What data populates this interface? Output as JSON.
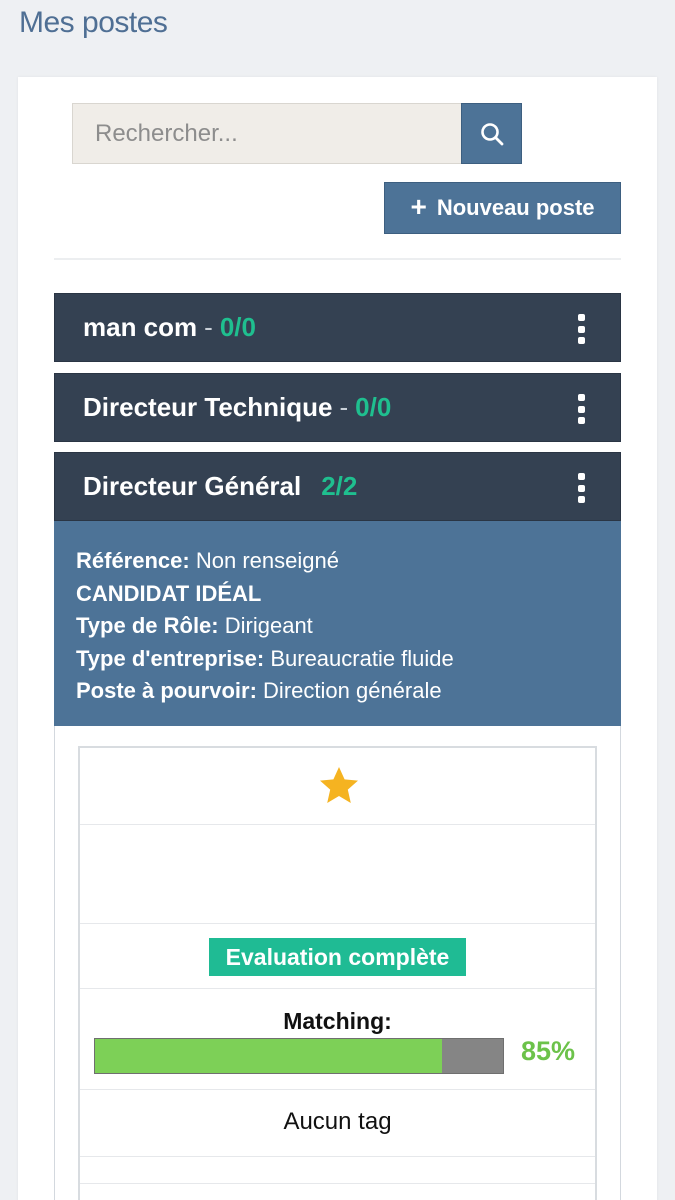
{
  "page": {
    "title": "Mes postes"
  },
  "search": {
    "placeholder": "Rechercher..."
  },
  "toolbar": {
    "new_post_label": "Nouveau poste"
  },
  "posts": [
    {
      "name": "man com",
      "separator": "-",
      "count": "0/0"
    },
    {
      "name": "Directeur Technique",
      "separator": "-",
      "count": "0/0"
    },
    {
      "name": "Directeur Général",
      "separator": "",
      "count": "2/2"
    }
  ],
  "details": {
    "reference_label": "Référence:",
    "reference_value": "Non renseigné",
    "ideal_candidate_label": "CANDIDAT IDÉAL",
    "role_type_label": "Type de Rôle:",
    "role_type_value": "Dirigeant",
    "company_type_label": "Type d'entreprise:",
    "company_type_value": "Bureaucratie fluide",
    "position_label": "Poste à pourvoir:",
    "position_value": "Direction générale"
  },
  "candidate_card": {
    "badge": "Evaluation complète",
    "matching_label": "Matching:",
    "matching_percent_text": "85%",
    "matching_fraction": 0.85,
    "tags_text": "Aucun tag"
  },
  "colors": {
    "header_row": "#344152",
    "accent_blue": "#4d7397",
    "count_green": "#1fbf8f",
    "badge_green": "#1fbb94",
    "progress_green": "#7dd057",
    "star": "#f5b321"
  },
  "icons": {
    "search": "search-icon",
    "add": "plus-icon",
    "menu": "kebab-menu-icon",
    "favorite": "star-icon"
  }
}
